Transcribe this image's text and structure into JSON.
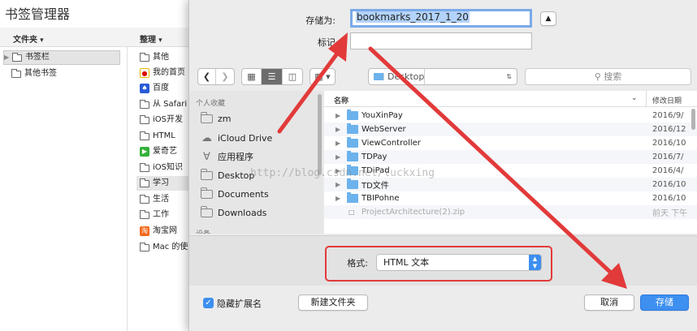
{
  "bookmark_manager": {
    "title": "书签管理器",
    "folders_menu": "文件夹",
    "organize_menu": "整理",
    "tree": [
      {
        "label": "书签栏",
        "selected": true
      },
      {
        "label": "其他书签",
        "selected": false
      }
    ],
    "items": [
      {
        "label": "其他",
        "icon": "folder-icon"
      },
      {
        "label": "我的首页",
        "icon": "weibo-icon"
      },
      {
        "label": "百度",
        "icon": "baidu-icon"
      },
      {
        "label": "从 Safari",
        "icon": "folder-icon"
      },
      {
        "label": "iOS开发",
        "icon": "folder-icon"
      },
      {
        "label": "HTML",
        "icon": "folder-icon"
      },
      {
        "label": "爱奇艺",
        "icon": "iqiyi-icon"
      },
      {
        "label": "iOS知识",
        "icon": "folder-icon"
      },
      {
        "label": "学习",
        "icon": "folder-icon"
      },
      {
        "label": "生活",
        "icon": "folder-icon"
      },
      {
        "label": "工作",
        "icon": "folder-icon"
      },
      {
        "label": "淘宝网",
        "icon": "taobao-icon"
      },
      {
        "label": "Mac 的使",
        "icon": "folder-icon"
      }
    ]
  },
  "dialog": {
    "save_as_label": "存储为:",
    "save_as_value": "bookmarks_2017_1_20",
    "tags_label": "标记",
    "location": "Desktop",
    "search_placeholder": "搜索",
    "sidebar": {
      "favorites_header": "个人收藏",
      "devices_header": "设备",
      "items": [
        {
          "label": "zm",
          "icon": "folder-icon"
        },
        {
          "label": "iCloud Drive",
          "icon": "cloud-icon"
        },
        {
          "label": "应用程序",
          "icon": "applications-icon"
        },
        {
          "label": "Desktop",
          "icon": "folder-icon"
        },
        {
          "label": "Documents",
          "icon": "folder-icon"
        },
        {
          "label": "Downloads",
          "icon": "folder-icon"
        }
      ]
    },
    "columns": {
      "name": "名称",
      "modified": "修改日期"
    },
    "files": [
      {
        "name": "YouXinPay",
        "date": "2016/9/",
        "folder": true
      },
      {
        "name": "WebServer",
        "date": "2016/12",
        "folder": true
      },
      {
        "name": "ViewController",
        "date": "2016/10",
        "folder": true
      },
      {
        "name": "TDPay",
        "date": "2016/7/",
        "folder": true
      },
      {
        "name": "TDiPad",
        "date": "2016/4/",
        "folder": true
      },
      {
        "name": "TD文件",
        "date": "2016/10",
        "folder": true
      },
      {
        "name": "TBIPohne",
        "date": "2016/10",
        "folder": true
      },
      {
        "name": "ProjectArchitecture(2).zip",
        "date": "前天 下午",
        "folder": false
      }
    ],
    "format_label": "格式:",
    "format_value": "HTML 文本",
    "hide_extension_label": "隐藏扩展名",
    "new_folder_button": "新建文件夹",
    "cancel_button": "取消",
    "save_button": "存储"
  },
  "watermark": "http://blog.csdn.net/luckxing",
  "colors": {
    "accent": "#3d8ff0",
    "annotation_red": "#e23a3a",
    "selection": "#b3d3fb"
  }
}
